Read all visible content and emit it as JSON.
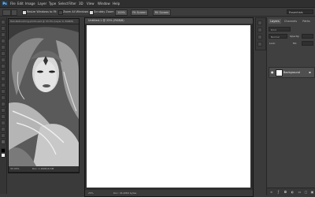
{
  "app": {
    "logo": "Ps",
    "menu": [
      "File",
      "Edit",
      "Image",
      "Layer",
      "Type",
      "Select",
      "Filter",
      "3D",
      "View",
      "Window",
      "Help"
    ]
  },
  "options": {
    "resize_label": "Resize Windows to Fit",
    "zoom_all_label": "Zoom All Windows",
    "scrubby_label": "Scrubby Zoom",
    "btn_100": "100%",
    "btn_fit": "Fit Screen",
    "btn_fill": "Fill Screen",
    "workspace": "Essentials"
  },
  "doc1": {
    "title": "Hair-Retouching-photo.psd @ 33.3% (Layer 0, RGB/8)",
    "zoom": "33.33%",
    "doc_size": "Doc: 1.29M/16.5M"
  },
  "doc2": {
    "title": "Untitled-1 @ 25% (RGB/8)",
    "zoom": "25%",
    "doc_size": "Doc: 34.4M/0 bytes"
  },
  "layers_panel": {
    "tabs": [
      "Layers",
      "Channels",
      "Paths"
    ],
    "kind_label": "Kind",
    "blend_mode": "Normal",
    "opacity_label": "Opacity:",
    "fill_label": "Fill:",
    "lock_label": "Lock:",
    "layer_name": "Background"
  }
}
